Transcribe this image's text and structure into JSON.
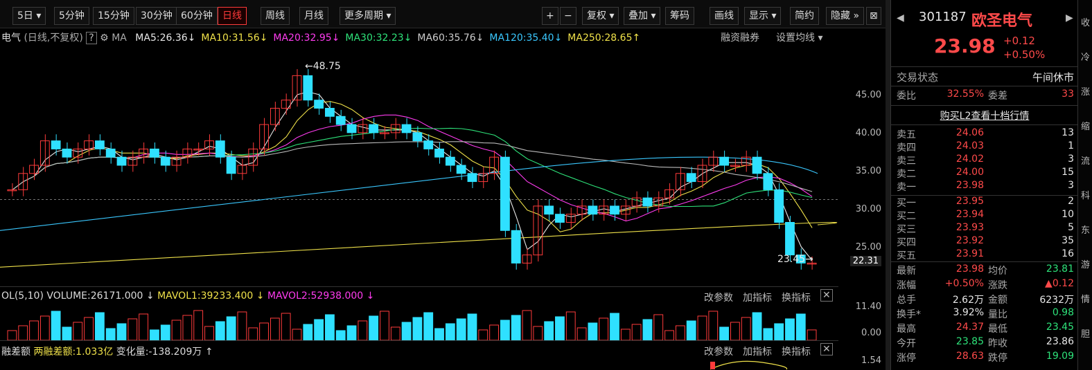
{
  "toolbar": {
    "partial_top_labels": [
      "…",
      "…"
    ],
    "buttons": [
      {
        "label": "5日",
        "dropdown": true
      },
      {
        "label": "5分钟"
      },
      {
        "label": "15分钟"
      },
      {
        "label": "30分钟"
      },
      {
        "label": "60分钟"
      },
      {
        "label": "日线",
        "active": true
      },
      {
        "label": "周线"
      },
      {
        "label": "月线"
      },
      {
        "label": "更多周期",
        "dropdown": true
      }
    ],
    "right_buttons": [
      {
        "label": "+"
      },
      {
        "label": "−"
      },
      {
        "label": "复权",
        "dropdown": true
      },
      {
        "label": "叠加",
        "dropdown": true
      },
      {
        "label": "筹码"
      },
      {
        "label": "画线"
      },
      {
        "label": "显示",
        "dropdown": true
      },
      {
        "label": "简约"
      },
      {
        "label": "隐藏"
      }
    ]
  },
  "chart_header": {
    "name_partial": "电气",
    "mode": "(日线,不复权)",
    "help": "?",
    "ma_label": "MA",
    "ma_values": [
      {
        "text": "MA5:26.36",
        "arrow": "↓",
        "color": "#e8e8e8"
      },
      {
        "text": "MA10:31.56",
        "arrow": "↓",
        "color": "#f0e24a"
      },
      {
        "text": "MA20:32.95",
        "arrow": "↓",
        "color": "#ff3cf0"
      },
      {
        "text": "MA30:32.23",
        "arrow": "↓",
        "color": "#2ee37a"
      },
      {
        "text": "MA60:35.76",
        "arrow": "↓",
        "color": "#cccccc"
      },
      {
        "text": "MA120:35.40",
        "arrow": "↓",
        "color": "#3ac8ff"
      },
      {
        "text": "MA250:28.65",
        "arrow": "↑",
        "color": "#f0e24a"
      }
    ],
    "margin_trading": "融资融券",
    "set_ma": "设置均线"
  },
  "price_axis": [
    "45.00",
    "40.00",
    "35.00",
    "30.00",
    "25.00"
  ],
  "current_price_tag": "22.31",
  "annotations": {
    "high": "48.75",
    "low": "23.45"
  },
  "volume_header": {
    "prefix": "OL(5,10)",
    "volume": "VOLUME:26171.000",
    "mavol1": "MAVOL1:39233.400",
    "mavol2": "MAVOL2:52938.000",
    "actions": [
      "改参数",
      "加指标",
      "换指标"
    ]
  },
  "volume_axis": [
    "11.40",
    "0.00"
  ],
  "margin_header": {
    "prefix": "融差额",
    "balance": "两融差额:1.033亿",
    "change": "变化量:-138.209万",
    "actions": [
      "改参数",
      "加指标",
      "换指标"
    ]
  },
  "margin_axis": [
    "1.54"
  ],
  "quote": {
    "code": "301187",
    "name": "欧圣电气",
    "price": "23.98",
    "change": "+0.12",
    "change_pct": "+0.50%",
    "status_label": "交易状态",
    "status_value": "午间休市",
    "weibi_label": "委比",
    "weibi_value": "32.55%",
    "weicha_label": "委差",
    "weicha_value": "33",
    "l2_link": "购买L2查看十档行情",
    "asks": [
      {
        "label": "卖五",
        "price": "24.06",
        "vol": "13"
      },
      {
        "label": "卖四",
        "price": "24.03",
        "vol": "1"
      },
      {
        "label": "卖三",
        "price": "24.02",
        "vol": "3"
      },
      {
        "label": "卖二",
        "price": "24.00",
        "vol": "15"
      },
      {
        "label": "卖一",
        "price": "23.98",
        "vol": "3"
      }
    ],
    "bids": [
      {
        "label": "买一",
        "price": "23.95",
        "vol": "2"
      },
      {
        "label": "买二",
        "price": "23.94",
        "vol": "10"
      },
      {
        "label": "买三",
        "price": "23.93",
        "vol": "5"
      },
      {
        "label": "买四",
        "price": "23.92",
        "vol": "35"
      },
      {
        "label": "买五",
        "price": "23.91",
        "vol": "16"
      }
    ],
    "stats": [
      {
        "l1": "最新",
        "v1": "23.98",
        "c1": "red",
        "l2": "均价",
        "v2": "23.81",
        "c2": "green"
      },
      {
        "l1": "涨幅",
        "v1": "+0.50%",
        "c1": "red",
        "l2": "涨跌",
        "v2": "▲0.12",
        "c2": "red"
      },
      {
        "l1": "总手",
        "v1": "2.62万",
        "c1": "white",
        "l2": "金额",
        "v2": "6232万",
        "c2": "white"
      },
      {
        "l1": "换手*",
        "v1": "3.92%",
        "c1": "white",
        "l2": "量比",
        "v2": "0.98",
        "c2": "green"
      },
      {
        "l1": "最高",
        "v1": "24.37",
        "c1": "red",
        "l2": "最低",
        "v2": "23.45",
        "c2": "green"
      },
      {
        "l1": "今开",
        "v1": "23.85",
        "c1": "green",
        "l2": "昨收",
        "v2": "23.86",
        "c2": "white"
      },
      {
        "l1": "涨停",
        "v1": "28.63",
        "c1": "red",
        "l2": "跌停",
        "v2": "19.09",
        "c2": "green"
      }
    ]
  },
  "edge_chars": [
    "收",
    "冷",
    "涨",
    "缩",
    "流",
    "科",
    "东",
    "游",
    "情",
    "胆"
  ],
  "colors": {
    "up": "#ff3b3b",
    "down": "#2fe0ff",
    "accent": "#ff3b3b"
  },
  "chart_data": {
    "type": "candlestick",
    "y_range": [
      22,
      50
    ],
    "highlight": {
      "max": 48.75,
      "min": 23.45
    },
    "closing_prices_approx": [
      33,
      35,
      36,
      39,
      38,
      37,
      38,
      39,
      38,
      37,
      36,
      37,
      38,
      37,
      36,
      37,
      38,
      38,
      39,
      37,
      35,
      36,
      38,
      41,
      43,
      44,
      47,
      44,
      43,
      42,
      41,
      40,
      41,
      40,
      40,
      41,
      40,
      39,
      38,
      37,
      36,
      35,
      34,
      35,
      37,
      28,
      24,
      25,
      31,
      30,
      29,
      30,
      31,
      30,
      31,
      30,
      31,
      32,
      31,
      32,
      33,
      35,
      34,
      36,
      37,
      36,
      36,
      37,
      35,
      33,
      29,
      25,
      24,
      24
    ]
  }
}
